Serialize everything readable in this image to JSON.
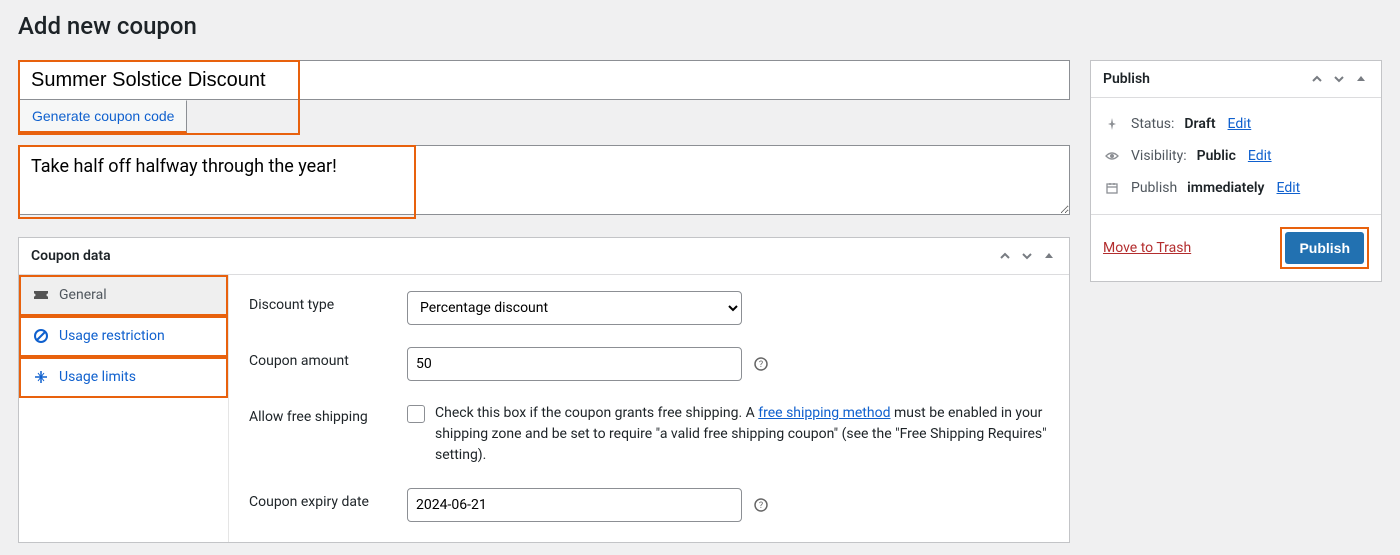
{
  "page_title": "Add new coupon",
  "coupon_title_value": "Summer Solstice Discount",
  "generate_label": "Generate coupon code",
  "description_value": "Take half off halfway through the year!",
  "coupon_data": {
    "heading": "Coupon data",
    "tabs": {
      "general": "General",
      "restriction": "Usage restriction",
      "limits": "Usage limits"
    },
    "fields": {
      "discount_type": {
        "label": "Discount type",
        "selected": "Percentage discount"
      },
      "coupon_amount": {
        "label": "Coupon amount",
        "value": "50"
      },
      "allow_free_shipping": {
        "label": "Allow free shipping",
        "text_before_link": "Check this box if the coupon grants free shipping. A ",
        "link_text": "free shipping method",
        "text_after_link": " must be enabled in your shipping zone and be set to require \"a valid free shipping coupon\" (see the \"Free Shipping Requires\" setting)."
      },
      "expiry": {
        "label": "Coupon expiry date",
        "value": "2024-06-21"
      }
    }
  },
  "publish": {
    "heading": "Publish",
    "status_label": "Status:",
    "status_value": "Draft",
    "visibility_label": "Visibility:",
    "visibility_value": "Public",
    "publish_label": "Publish",
    "publish_value": "immediately",
    "edit_link": "Edit",
    "trash_label": "Move to Trash",
    "button_label": "Publish"
  }
}
